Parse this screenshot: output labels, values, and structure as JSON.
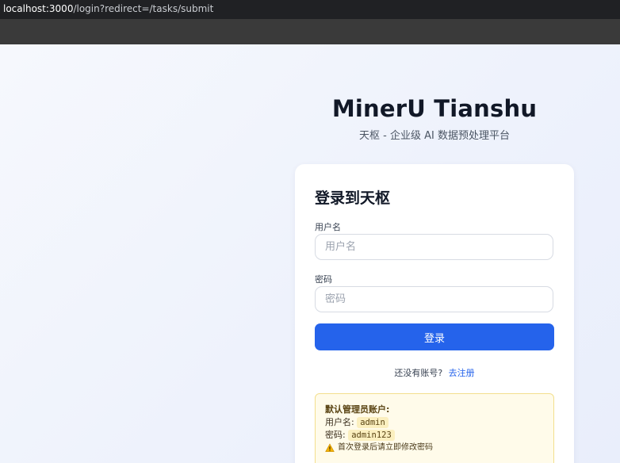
{
  "browser": {
    "url_host": "localhost:3000",
    "url_path": "/login?redirect=/tasks/submit"
  },
  "brand": {
    "title": "MinerU Tianshu",
    "subtitle": "天枢 - 企业级 AI 数据预处理平台"
  },
  "login_card": {
    "title": "登录到天枢",
    "username_label": "用户名",
    "username_placeholder": "用户名",
    "username_value": "",
    "password_label": "密码",
    "password_placeholder": "密码",
    "password_value": "",
    "submit_label": "登录",
    "register_prompt": "还没有账号?",
    "register_link": "去注册"
  },
  "default_admin": {
    "title": "默认管理员账户:",
    "username_label": "用户名:",
    "username_value": "admin",
    "password_label": "密码:",
    "password_value": "admin123",
    "warning_icon": "warning-triangle-icon",
    "warning_text": "首次登录后请立即修改密码"
  },
  "colors": {
    "accent": "#2563eb",
    "notice_bg": "#fffbea",
    "notice_border": "#f3df8e"
  }
}
